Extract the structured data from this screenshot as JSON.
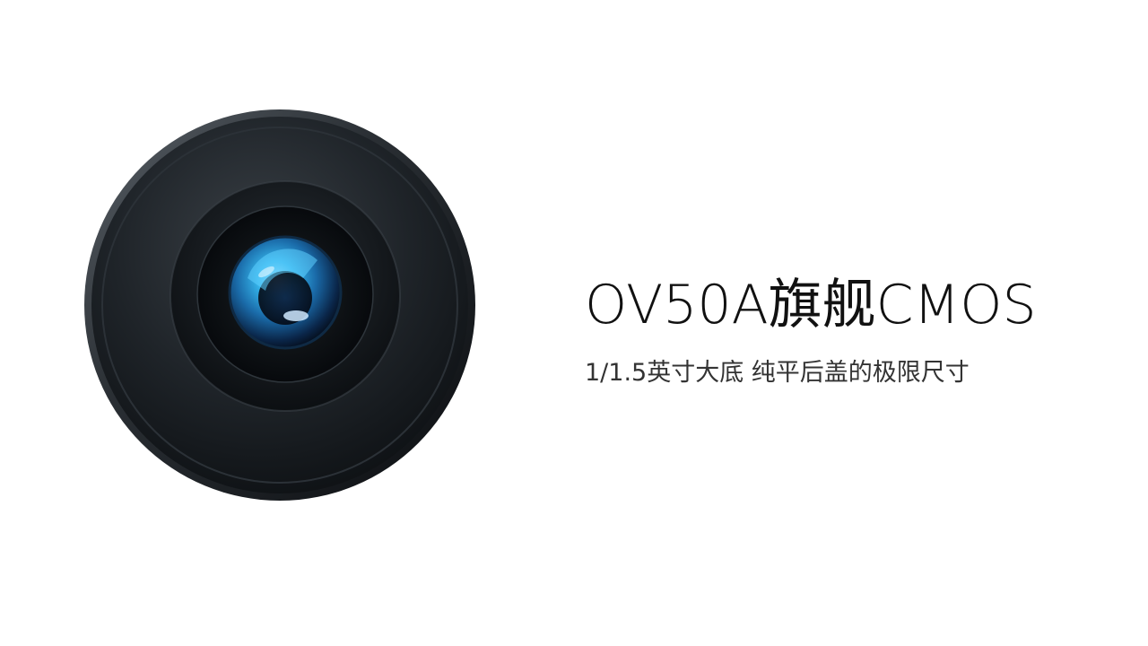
{
  "headline": "OV50A旗舰CMOS",
  "subline": "1/1.5英寸大底 纯平后盖的极限尺寸",
  "image": {
    "icon": "camera-lens-icon",
    "colors": {
      "housing": "#1c2024",
      "inner_ring": "#101317",
      "glass_blue": "#2a9ed8",
      "glass_dark": "#0a1a2e"
    }
  }
}
